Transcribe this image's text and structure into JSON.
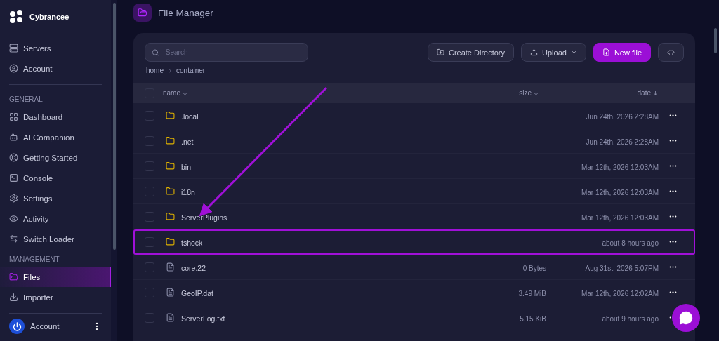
{
  "brand": {
    "name": "Cybrancee"
  },
  "sidebar": {
    "sections": [
      {
        "items": [
          {
            "label": "Servers",
            "selected": false
          },
          {
            "label": "Account",
            "selected": false
          }
        ]
      },
      {
        "heading": "GENERAL",
        "items": [
          {
            "label": "Dashboard",
            "selected": false
          },
          {
            "label": "AI Companion",
            "selected": false
          },
          {
            "label": "Getting Started",
            "selected": false
          },
          {
            "label": "Console",
            "selected": false
          },
          {
            "label": "Settings",
            "selected": false
          },
          {
            "label": "Activity",
            "selected": false
          },
          {
            "label": "Switch Loader",
            "selected": false
          }
        ]
      },
      {
        "heading": "MANAGEMENT",
        "items": [
          {
            "label": "Files",
            "selected": true
          },
          {
            "label": "Importer",
            "selected": false
          }
        ]
      }
    ],
    "footer": {
      "label": "Account"
    }
  },
  "page": {
    "title": "File Manager"
  },
  "toolbar": {
    "search": {
      "placeholder": "Search"
    },
    "buttons": [
      {
        "label": "Create Directory",
        "kind": "plain"
      },
      {
        "label": "Upload",
        "kind": "dropdown"
      },
      {
        "label": "New file",
        "kind": "primary"
      }
    ]
  },
  "breadcrumb": [
    "home",
    "container"
  ],
  "table": {
    "select_all_checked": false,
    "columns": [
      {
        "label": "name",
        "sorted": true
      },
      {
        "label": "size",
        "sorted": true
      },
      {
        "label": "date",
        "sorted": true
      }
    ],
    "rows": [
      {
        "kind": "folder",
        "name": ".local",
        "date": "Jun 24th, 2026 2:28AM",
        "checked": false,
        "highlighted": false
      },
      {
        "kind": "folder",
        "name": ".net",
        "date": "Jun 24th, 2026 2:28AM",
        "checked": false,
        "highlighted": false
      },
      {
        "kind": "folder",
        "name": "bin",
        "date": "Mar 12th, 2026 12:03AM",
        "checked": false,
        "highlighted": false
      },
      {
        "kind": "folder",
        "name": "i18n",
        "date": "Mar 12th, 2026 12:03AM",
        "checked": false,
        "highlighted": false
      },
      {
        "kind": "folder",
        "name": "ServerPlugins",
        "date": "Mar 12th, 2026 12:03AM",
        "checked": false,
        "highlighted": false
      },
      {
        "kind": "folder",
        "name": "tshock",
        "date": "about 8 hours ago",
        "checked": false,
        "highlighted": true
      },
      {
        "kind": "file",
        "name": "core.22",
        "size": "0 Bytes",
        "date": "Aug 31st, 2026 5:07PM",
        "checked": false,
        "highlighted": false
      },
      {
        "kind": "file",
        "name": "GeoIP.dat",
        "size": "3.49 MiB",
        "date": "Mar 12th, 2026 12:02AM",
        "checked": false,
        "highlighted": false
      },
      {
        "kind": "file",
        "name": "ServerLog.txt",
        "size": "5.15 KiB",
        "date": "about 9 hours ago",
        "checked": false,
        "highlighted": false
      }
    ]
  }
}
